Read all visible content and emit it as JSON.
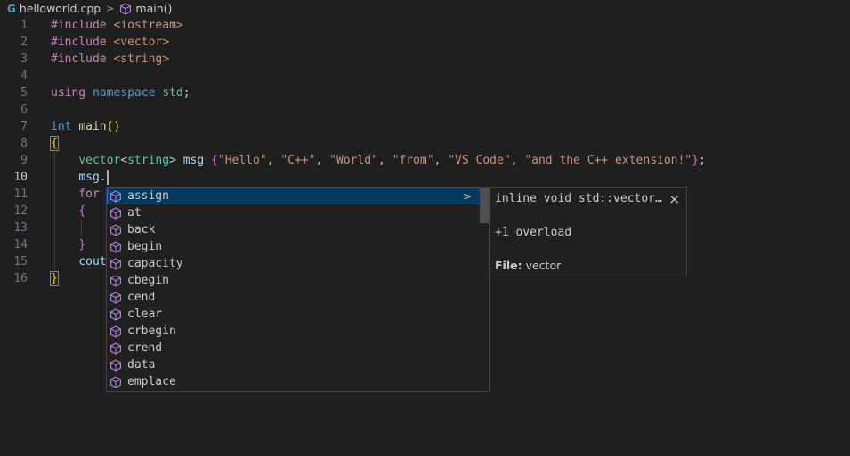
{
  "breadcrumb": {
    "file_icon": "cpp-file-icon",
    "file": "helloworld.cpp",
    "separator": ">",
    "symbol_icon": "method-cube-icon",
    "symbol": "main()"
  },
  "editor": {
    "active_line": 10,
    "lines": [
      {
        "num": "1",
        "tokens": [
          {
            "t": "#include ",
            "c": "c-ctrl"
          },
          {
            "t": "<iostream>",
            "c": "c-str"
          }
        ]
      },
      {
        "num": "2",
        "tokens": [
          {
            "t": "#include ",
            "c": "c-ctrl"
          },
          {
            "t": "<vector>",
            "c": "c-str"
          }
        ]
      },
      {
        "num": "3",
        "tokens": [
          {
            "t": "#include ",
            "c": "c-ctrl"
          },
          {
            "t": "<string>",
            "c": "c-str"
          }
        ]
      },
      {
        "num": "4",
        "tokens": []
      },
      {
        "num": "5",
        "tokens": [
          {
            "t": "using ",
            "c": "c-ctrl"
          },
          {
            "t": "namespace ",
            "c": "c-kw"
          },
          {
            "t": "std",
            "c": "c-type"
          },
          {
            "t": ";",
            "c": "c-plain"
          }
        ]
      },
      {
        "num": "6",
        "tokens": []
      },
      {
        "num": "7",
        "tokens": [
          {
            "t": "int ",
            "c": "c-kw"
          },
          {
            "t": "main",
            "c": "c-fn"
          },
          {
            "t": "()",
            "c": "c-brace"
          }
        ]
      },
      {
        "num": "8",
        "tokens": [
          {
            "t": "{",
            "c": "c-brace brace-hl"
          }
        ]
      },
      {
        "num": "9",
        "tokens": [
          {
            "t": "    ",
            "c": "c-plain"
          },
          {
            "t": "vector",
            "c": "c-type"
          },
          {
            "t": "<",
            "c": "c-plain"
          },
          {
            "t": "string",
            "c": "c-type"
          },
          {
            "t": "> ",
            "c": "c-plain"
          },
          {
            "t": "msg ",
            "c": "c-var"
          },
          {
            "t": "{",
            "c": "c-brace2"
          },
          {
            "t": "\"Hello\"",
            "c": "c-str"
          },
          {
            "t": ", ",
            "c": "c-plain"
          },
          {
            "t": "\"C++\"",
            "c": "c-str"
          },
          {
            "t": ", ",
            "c": "c-plain"
          },
          {
            "t": "\"World\"",
            "c": "c-str"
          },
          {
            "t": ", ",
            "c": "c-plain"
          },
          {
            "t": "\"from\"",
            "c": "c-str"
          },
          {
            "t": ", ",
            "c": "c-plain"
          },
          {
            "t": "\"VS Code\"",
            "c": "c-str"
          },
          {
            "t": ", ",
            "c": "c-plain"
          },
          {
            "t": "\"and the C++ extension!\"",
            "c": "c-str"
          },
          {
            "t": "}",
            "c": "c-brace2"
          },
          {
            "t": ";",
            "c": "c-plain"
          }
        ]
      },
      {
        "num": "10",
        "tokens": [
          {
            "t": "    ",
            "c": "c-plain"
          },
          {
            "t": "msg",
            "c": "c-var"
          },
          {
            "t": ".",
            "c": "c-plain"
          }
        ],
        "cursor": true
      },
      {
        "num": "11",
        "tokens": [
          {
            "t": "    ",
            "c": "c-plain"
          },
          {
            "t": "for",
            "c": "c-ctrl"
          }
        ]
      },
      {
        "num": "12",
        "tokens": [
          {
            "t": "    ",
            "c": "c-plain"
          },
          {
            "t": "{",
            "c": "c-brace2"
          }
        ]
      },
      {
        "num": "13",
        "tokens": []
      },
      {
        "num": "14",
        "tokens": [
          {
            "t": "    ",
            "c": "c-plain"
          },
          {
            "t": "}",
            "c": "c-brace2"
          }
        ]
      },
      {
        "num": "15",
        "tokens": [
          {
            "t": "    ",
            "c": "c-plain"
          },
          {
            "t": "cout",
            "c": "c-var"
          }
        ]
      },
      {
        "num": "16",
        "tokens": [
          {
            "t": "}",
            "c": "c-brace brace-hl"
          }
        ]
      }
    ]
  },
  "suggest": {
    "item_icon": "method-cube-icon",
    "expand_icon": ">",
    "items": [
      "assign",
      "at",
      "back",
      "begin",
      "capacity",
      "cbegin",
      "cend",
      "clear",
      "crbegin",
      "crend",
      "data",
      "emplace"
    ],
    "selected_index": 0
  },
  "details": {
    "signature": "inline void std::vector…",
    "close_label": "×",
    "overload": "+1 overload",
    "file_label": "File:",
    "file_value": "vector"
  },
  "colors": {
    "background": "#1f1f1f",
    "method_icon": "#b180d7",
    "selection": "#04395e",
    "focus_border": "#0078d4"
  }
}
